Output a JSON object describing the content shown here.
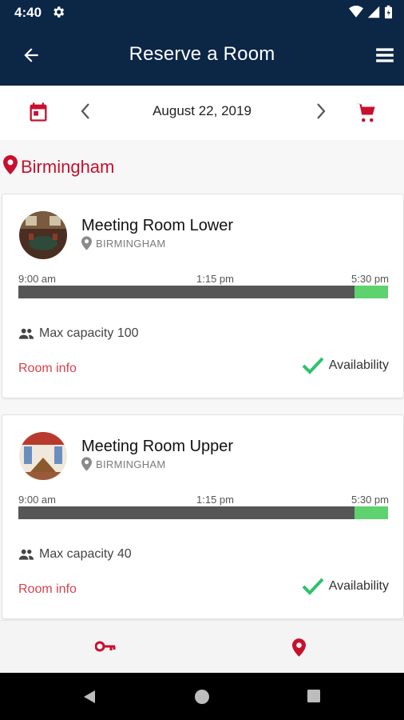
{
  "status_bar": {
    "time": "4:40",
    "icons": [
      "gear-icon",
      "wifi-icon",
      "signal-icon",
      "battery-icon"
    ]
  },
  "app_bar": {
    "title": "Reserve a Room",
    "back_icon": "arrow-left-icon",
    "menu_icon": "hamburger-menu-icon"
  },
  "date_bar": {
    "date": "August 22, 2019",
    "calendar_icon": "calendar-icon",
    "cart_icon": "cart-icon"
  },
  "location": {
    "city": "Birmingham"
  },
  "rooms": [
    {
      "name": "Meeting Room Lower",
      "location": "BIRMINGHAM",
      "timeline": {
        "start": "9:00 am",
        "mid": "1:15 pm",
        "end": "5:30 pm",
        "available_from_fraction": 0.91
      },
      "capacity": "Max capacity 100",
      "room_info": "Room info",
      "availability": "Availability"
    },
    {
      "name": "Meeting Room Upper",
      "location": "BIRMINGHAM",
      "timeline": {
        "start": "9:00 am",
        "mid": "1:15 pm",
        "end": "5:30 pm",
        "available_from_fraction": 0.91
      },
      "capacity": "Max capacity 40",
      "room_info": "Room info",
      "availability": "Availability"
    }
  ],
  "bottom_nav": {
    "items": [
      "key-icon",
      "map-pin-icon"
    ]
  },
  "colors": {
    "header": "#0c2646",
    "accent_red": "#c8102e",
    "available_green": "#5dd26f",
    "booked_gray": "#565656"
  }
}
